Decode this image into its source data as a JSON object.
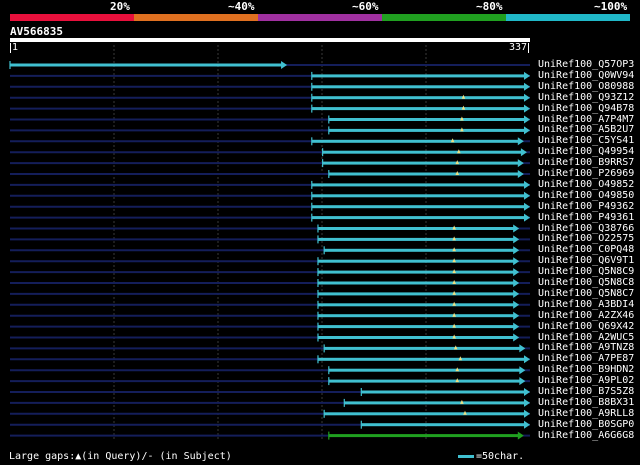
{
  "scale": {
    "labels": [
      "20%",
      "~40%",
      "~60%",
      "~80%",
      "~100%"
    ],
    "colors": [
      "#e8103c",
      "#e07020",
      "#a030a0",
      "#20a020",
      "#20b8c8"
    ]
  },
  "query": {
    "name": "AV566835",
    "start": "1",
    "end": "337",
    "length": 337
  },
  "colors": {
    "hit": "#40c0d0",
    "hit_alt": "#20a020",
    "track": "#141e5a",
    "gridline": "#3a3a3a",
    "gap_marker": "#f0e080"
  },
  "hits": [
    {
      "id": "UniRef100_Q57OP3",
      "start": 1,
      "end": 180,
      "gap": null
    },
    {
      "id": "UniRef100_Q0WV94",
      "start": 196,
      "end": 337,
      "gap": null
    },
    {
      "id": "UniRef100_O80988",
      "start": 196,
      "end": 337,
      "gap": null
    },
    {
      "id": "UniRef100_Q93Z12",
      "start": 196,
      "end": 337,
      "gap": 294
    },
    {
      "id": "UniRef100_Q94B78",
      "start": 196,
      "end": 337,
      "gap": 294
    },
    {
      "id": "UniRef100_A7P4M7",
      "start": 207,
      "end": 337,
      "gap": 293
    },
    {
      "id": "UniRef100_A5B2U7",
      "start": 207,
      "end": 337,
      "gap": 293
    },
    {
      "id": "UniRef100_C5YS41",
      "start": 196,
      "end": 333,
      "gap": 287
    },
    {
      "id": "UniRef100_Q49954",
      "start": 203,
      "end": 335,
      "gap": 291
    },
    {
      "id": "UniRef100_B9RRS7",
      "start": 203,
      "end": 333,
      "gap": 290
    },
    {
      "id": "UniRef100_P26969",
      "start": 207,
      "end": 333,
      "gap": 290
    },
    {
      "id": "UniRef100_O49852",
      "start": 196,
      "end": 337,
      "gap": null
    },
    {
      "id": "UniRef100_O49850",
      "start": 196,
      "end": 337,
      "gap": null
    },
    {
      "id": "UniRef100_P49362",
      "start": 196,
      "end": 337,
      "gap": null
    },
    {
      "id": "UniRef100_P49361",
      "start": 196,
      "end": 337,
      "gap": null
    },
    {
      "id": "UniRef100_Q38766",
      "start": 200,
      "end": 330,
      "gap": 288
    },
    {
      "id": "UniRef100_O22575",
      "start": 200,
      "end": 330,
      "gap": 288
    },
    {
      "id": "UniRef100_C0PQ48",
      "start": 204,
      "end": 330,
      "gap": 288
    },
    {
      "id": "UniRef100_Q6V9T1",
      "start": 200,
      "end": 330,
      "gap": 288
    },
    {
      "id": "UniRef100_Q5N8C9",
      "start": 200,
      "end": 330,
      "gap": 288
    },
    {
      "id": "UniRef100_Q5N8C8",
      "start": 200,
      "end": 330,
      "gap": 288
    },
    {
      "id": "UniRef100_Q5N8C7",
      "start": 200,
      "end": 330,
      "gap": 288
    },
    {
      "id": "UniRef100_A3BDI4",
      "start": 200,
      "end": 330,
      "gap": 288
    },
    {
      "id": "UniRef100_A2ZX46",
      "start": 200,
      "end": 330,
      "gap": 288
    },
    {
      "id": "UniRef100_Q69X42",
      "start": 200,
      "end": 330,
      "gap": 288
    },
    {
      "id": "UniRef100_A2WUC5",
      "start": 200,
      "end": 330,
      "gap": 288
    },
    {
      "id": "UniRef100_A9TNZ8",
      "start": 204,
      "end": 334,
      "gap": 289
    },
    {
      "id": "UniRef100_A7PE87",
      "start": 200,
      "end": 337,
      "gap": 292
    },
    {
      "id": "UniRef100_B9HDN2",
      "start": 207,
      "end": 334,
      "gap": 290
    },
    {
      "id": "UniRef100_A9PL02",
      "start": 207,
      "end": 334,
      "gap": 290
    },
    {
      "id": "UniRef100_B7S5Z8",
      "start": 228,
      "end": 337,
      "gap": null
    },
    {
      "id": "UniRef100_B8BX31",
      "start": 217,
      "end": 337,
      "gap": 293
    },
    {
      "id": "UniRef100_A9RLL8",
      "start": 204,
      "end": 337,
      "gap": 295
    },
    {
      "id": "UniRef100_B0SGP0",
      "start": 228,
      "end": 337,
      "gap": null
    },
    {
      "id": "UniRef100_A6G6G8",
      "start": 207,
      "end": 333,
      "gap": null,
      "color": "green"
    }
  ],
  "footer": {
    "large_gaps_text": "Large gaps:▲(in Query)/- (in Subject)",
    "legend_text": "=50char."
  }
}
